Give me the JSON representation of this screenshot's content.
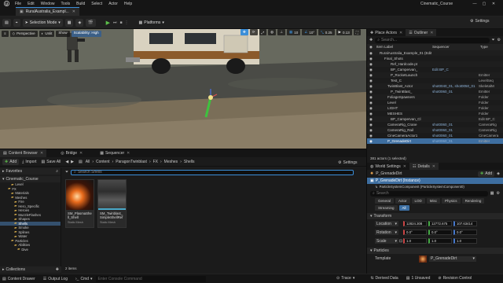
{
  "app": {
    "menu": [
      "File",
      "Edit",
      "Window",
      "Tools",
      "Build",
      "Select",
      "Actor",
      "Help"
    ],
    "project_title": "Cinematic_Course",
    "level_tab": "RuralAustralia_Exampl...",
    "settings_label": "Settings"
  },
  "toolbar": {
    "selection_mode": "Selection Mode",
    "platforms": "Platforms"
  },
  "viewport": {
    "perspective": "Perspective",
    "lit": "Unlit",
    "show": "Show",
    "scalability": "Scalability: High",
    "grid_value": "10",
    "rot_value": "10°",
    "scale_value": "0.25",
    "cam_speed": "0.13"
  },
  "outliner": {
    "tab_place": "Place Actors",
    "tab_outliner": "Outliner",
    "search_placeholder": "Search...",
    "col_label": "Item Label",
    "col_sequencer": "Sequencer",
    "col_type": "Type",
    "rows": [
      {
        "name": "RuralAustralia_Example_01 (Editor)",
        "indent": 4,
        "lbl": "",
        "type": "",
        "sel": false
      },
      {
        "name": "Final_Shots",
        "indent": 10,
        "lbl": "",
        "type": "",
        "sel": false
      },
      {
        "name": "Ref_Hardcode.pt",
        "indent": 18,
        "lbl": "",
        "type": "",
        "sel": false
      },
      {
        "name": "BP_Campervan_",
        "indent": 18,
        "lbl": "Edit BP_C",
        "type": "",
        "sel": false
      },
      {
        "name": "P_RocketLaunch",
        "indent": 18,
        "lbl": "",
        "type": "Emitter",
        "sel": false
      },
      {
        "name": "Test_C",
        "indent": 18,
        "lbl": "",
        "type": "LevelSeq",
        "sel": false
      },
      {
        "name": "TwinBlast_Actor",
        "indent": 14,
        "lbl": "shot0040_01, shot0050_01",
        "type": "SkeletalM",
        "sel": false
      },
      {
        "name": "P_TwinBlast_",
        "indent": 18,
        "lbl": "shot0060_01",
        "type": "Emitter",
        "sel": false
      },
      {
        "name": "FoliageSpawners",
        "indent": 14,
        "lbl": "",
        "type": "Folder",
        "sel": false
      },
      {
        "name": "Level",
        "indent": 14,
        "lbl": "",
        "type": "Folder",
        "sel": false
      },
      {
        "name": "LIGHT",
        "indent": 14,
        "lbl": "",
        "type": "Folder",
        "sel": false
      },
      {
        "name": "MESHES",
        "indent": 14,
        "lbl": "",
        "type": "Folder",
        "sel": false
      },
      {
        "name": "BP_Campervan_Cl",
        "indent": 18,
        "lbl": "",
        "type": "Edit BP_C",
        "sel": false
      },
      {
        "name": "CameraRig_Crane",
        "indent": 14,
        "lbl": "shot0060_01",
        "type": "CameraRig",
        "sel": false
      },
      {
        "name": "CameraRig_Rail",
        "indent": 14,
        "lbl": "shot0060_01",
        "type": "CameraRig",
        "sel": false
      },
      {
        "name": "CineCameraActor1",
        "indent": 14,
        "lbl": "shot0060_01",
        "type": "CineCamera",
        "sel": false
      },
      {
        "name": "P_GrenadeDirt",
        "indent": 14,
        "lbl": "shot0060_01",
        "type": "Emitter",
        "sel": true
      }
    ],
    "count": "381 actors (1 selected)"
  },
  "details": {
    "tab_world": "World Settings",
    "tab_details": "Details",
    "actor_name": "P_GrenadeDirt",
    "add_label": "Add",
    "instance": "P_GrenadeDirt (Instance)",
    "component": "ParticleSystemComponent (ParticleSystemComponent0)",
    "search_placeholder": "Search",
    "tabs_row1": [
      "General",
      "Actor",
      "LOD",
      "Misc",
      "Physics",
      "Rendering"
    ],
    "tabs_row2": [
      "Streaming",
      "All"
    ],
    "section_transform": "Transform",
    "location_label": "Location",
    "location": [
      "12824.308",
      "12772.675",
      "107.63414"
    ],
    "rotation_label": "Rotation",
    "rotation": [
      "0.0°",
      "0.0°",
      "0.0°"
    ],
    "scale_label": "Scale",
    "scale": [
      "1.0",
      "1.0",
      "1.0"
    ],
    "section_particles": "Particles",
    "template_label": "Template",
    "template_value": "P_GrenadeDirt"
  },
  "content_browser": {
    "tab_cb": "Content Browser",
    "tab_bridge": "Bridge",
    "tab_sequencer": "Sequencer",
    "add": "Add",
    "import": "Import",
    "save_all": "Save All",
    "breadcrumb": [
      "All",
      "Content",
      "ParagonTwinblast",
      "FX",
      "Meshes",
      "Shells"
    ],
    "settings": "Settings",
    "favorites": "Favorites",
    "project": "Cinematic_Course",
    "search_placeholder": "Search Shells",
    "tree": [
      {
        "name": "Level",
        "indent": 14,
        "sel": false
      },
      {
        "name": "FX",
        "indent": 10,
        "sel": false
      },
      {
        "name": "Materials",
        "indent": 14,
        "sel": false
      },
      {
        "name": "Meshes",
        "indent": 14,
        "sel": false
      },
      {
        "name": "Fire",
        "indent": 18,
        "sel": false
      },
      {
        "name": "Hero_Specific",
        "indent": 18,
        "sel": false
      },
      {
        "name": "Heroes",
        "indent": 18,
        "sel": false
      },
      {
        "name": "MuzzleFlashes",
        "indent": 18,
        "sel": false
      },
      {
        "name": "Shapes",
        "indent": 18,
        "sel": false
      },
      {
        "name": "Shells",
        "indent": 18,
        "sel": true
      },
      {
        "name": "Smoke",
        "indent": 18,
        "sel": false
      },
      {
        "name": "Splines",
        "indent": 18,
        "sel": false
      },
      {
        "name": "Water",
        "indent": 18,
        "sel": false
      },
      {
        "name": "Particles",
        "indent": 14,
        "sel": false
      },
      {
        "name": "Abilities",
        "indent": 18,
        "sel": false
      },
      {
        "name": "Dive",
        "indent": 22,
        "sel": false
      }
    ],
    "assets": [
      {
        "name": "SM_PlasmaShell_Shell",
        "kind": "Static Mesh"
      },
      {
        "name": "SM_Twinblast_SimpleShellRef",
        "kind": "Static Mesh"
      }
    ],
    "items_count": "2 items",
    "collections": "Collections"
  },
  "statusbar": {
    "content_drawer": "Content Drawer",
    "output_log": "Output Log",
    "cmd": "Cmd",
    "console_placeholder": "Enter Console Command",
    "trace": "Trace",
    "derived_data": "Derived Data",
    "unsaved": "1 Unsaved",
    "revision_control": "Revision Control"
  },
  "colors": {
    "accent_blue": "#3b8ed8",
    "select_blue": "#3e6ea0",
    "play_green": "#5cbf4a",
    "add_green": "#4e8f3a"
  }
}
